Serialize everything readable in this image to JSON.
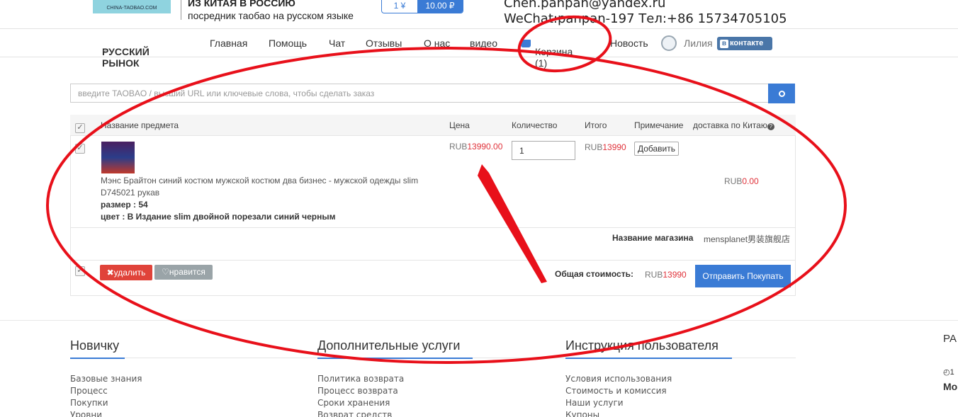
{
  "header": {
    "logo_text": "CHINA-TAOBAO.COM",
    "tagline_line1": "ИЗ КИТАЯ В РОССИЮ",
    "tagline_line2": "посредник таобао на русском языке",
    "rate_left": "1 ¥",
    "rate_right": "10.00 ₽",
    "email": "Chen.panpan@yandex.ru",
    "wechat": "WeChat:panpan-197  Тел:+86 15734705105"
  },
  "nav": {
    "market": "РУССКИЙ РЫНОК",
    "market_caret": "⌄",
    "items": [
      "Главная",
      "Помощь",
      "Чат",
      "Отзывы",
      "О нас",
      "видео"
    ],
    "cart": "Корзина (1)",
    "news": "Новость",
    "user": "Лилия",
    "vk_label": "контакте",
    "vk_letter": "в"
  },
  "search": {
    "placeholder": "введите TAOBAO / высший URL или ключевые слова, чтобы сделать заказ"
  },
  "table": {
    "headers": {
      "name": "Название предмета",
      "price": "Цена",
      "qty": "Количество",
      "total": "Итого",
      "note": "Примечание",
      "shipping": "доставка по Китаю"
    },
    "item": {
      "name": "Мэнс Брайтон синий костюм мужской костюм два бизнес - мужской одежды slim D745021 рукав",
      "size": "размер : 54",
      "color": "цвет : В Издание slim двойной порезали синий черным",
      "price_cur": "RUB",
      "price_val": "13990.00",
      "qty": "1",
      "total_cur": "RUB",
      "total_val": "13990",
      "add_label": "Добавить",
      "ship_cur": "RUB",
      "ship_val": "0.00"
    },
    "shop_label": "Название магазина",
    "shop_value": "mensplanet男装旗舰店",
    "delete_label": "удалить",
    "like_label": "нравится",
    "total_label": "Общая стоимость:",
    "total_cur": "RUB",
    "total_val": "13990",
    "buy_label": "Отправить Покупать"
  },
  "footer": {
    "col1": {
      "title": "Новичку",
      "links": [
        "Базовые знания",
        "Процесс",
        "Покупки",
        "Уровни"
      ]
    },
    "col2": {
      "title": "Дополнительные услуги",
      "links": [
        "Политика возврата",
        "Процесс возврата",
        "Сроки хранения",
        "Возврат средств"
      ]
    },
    "col3": {
      "title": "Инструкция пользователя",
      "links": [
        "Условия использования",
        "Стоимость и комиссия",
        "Наши услуги",
        "Купоны"
      ]
    },
    "edge_top": "РА",
    "edge_mid": "◴1",
    "edge_bot": "Мо"
  },
  "colors": {
    "accent": "#3a7bd5",
    "price_red": "#e0323a",
    "annotation": "#e8101a"
  }
}
